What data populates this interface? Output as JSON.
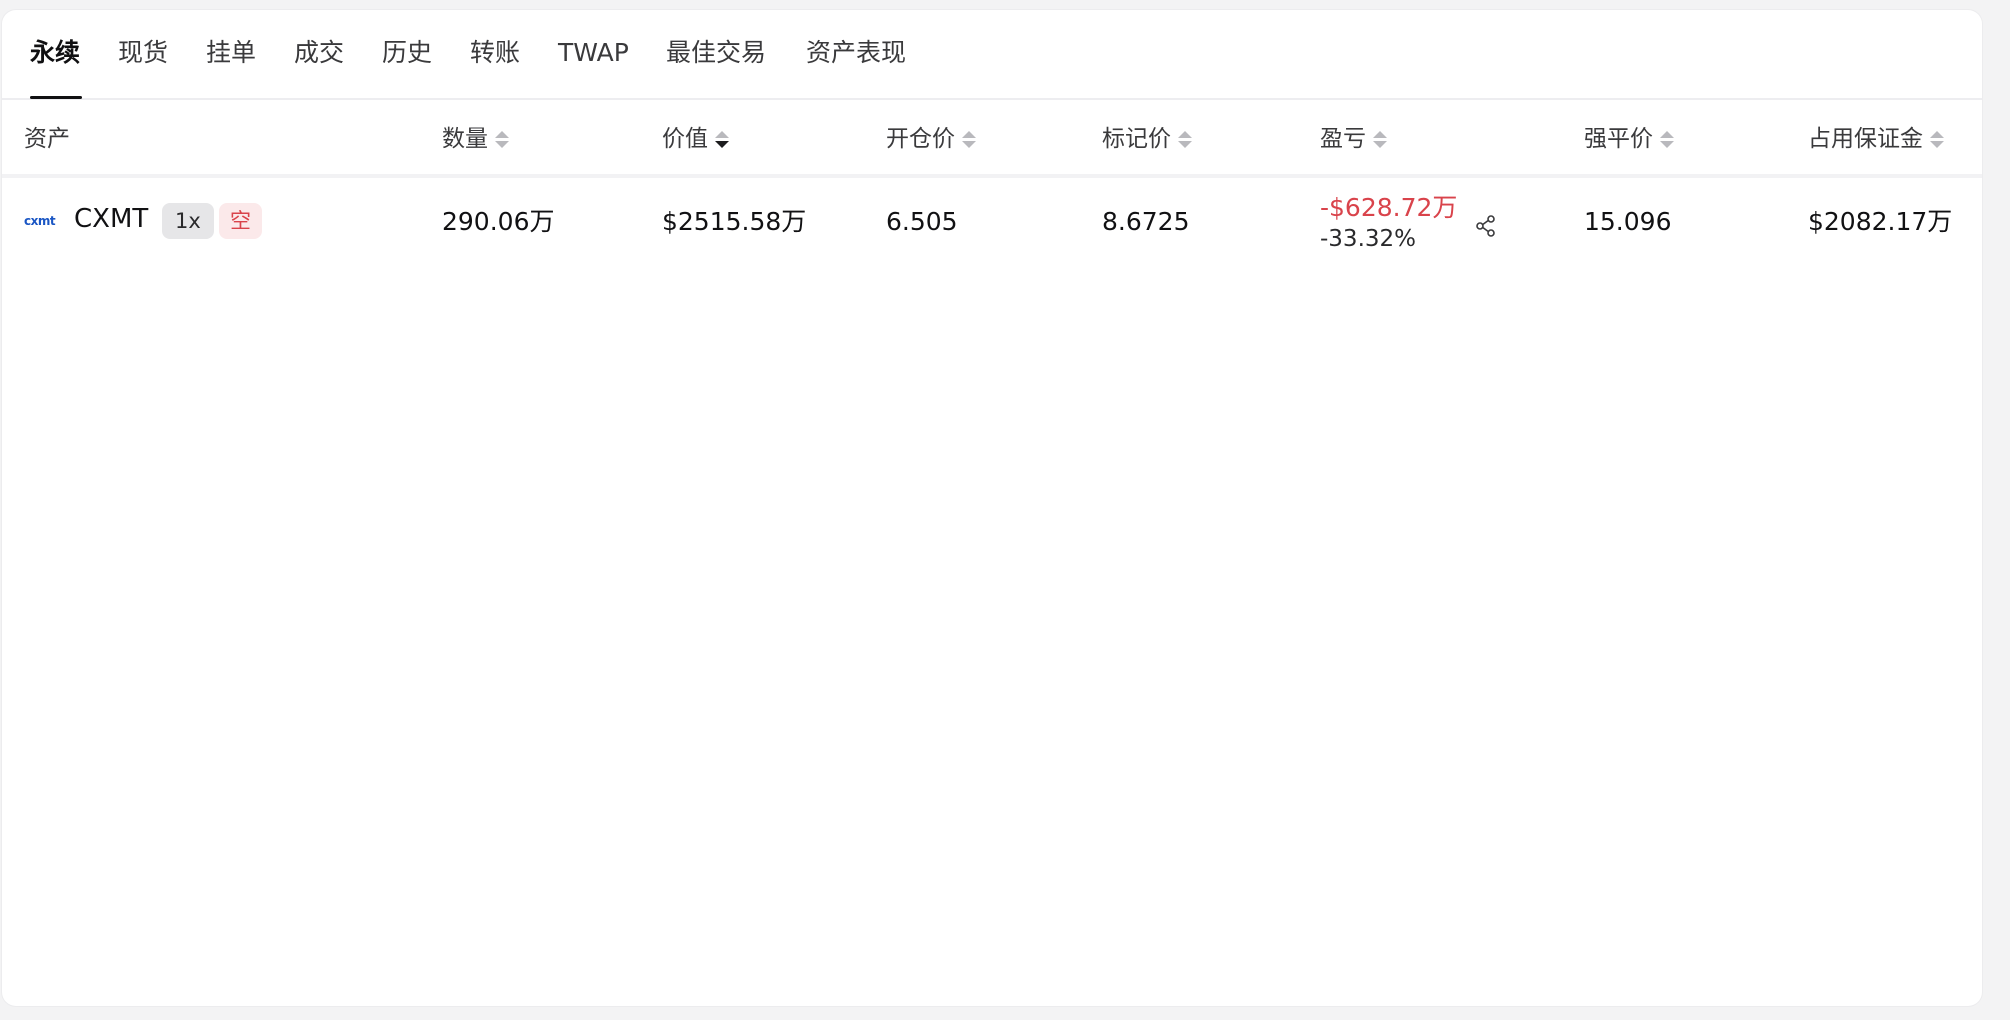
{
  "tabs": [
    {
      "label": "永续",
      "active": true
    },
    {
      "label": "现货"
    },
    {
      "label": "挂单"
    },
    {
      "label": "成交"
    },
    {
      "label": "历史"
    },
    {
      "label": "转账"
    },
    {
      "label": "TWAP"
    },
    {
      "label": "最佳交易"
    },
    {
      "label": "资产表现"
    }
  ],
  "columns": {
    "asset": "资产",
    "quantity": "数量",
    "value": "价值",
    "entry_price": "开仓价",
    "mark_price": "标记价",
    "pnl": "盈亏",
    "liq_price": "强平价",
    "margin": "占用保证金"
  },
  "sort": {
    "column": "value",
    "direction": "desc"
  },
  "position": {
    "logo_text": "cxmt",
    "asset": "CXMT",
    "leverage": "1x",
    "side": "空",
    "quantity": "290.06万",
    "value": "$2515.58万",
    "entry_price": "6.505",
    "mark_price": "8.6725",
    "pnl": "-$628.72万",
    "pnl_pct": "-33.32%",
    "liq_price": "15.096",
    "margin": "$2082.17万"
  },
  "icons": {
    "share": "share-icon"
  },
  "colors": {
    "loss": "#d9434b",
    "logo": "#1a56c4",
    "short_badge_bg": "#fbe9ea"
  }
}
